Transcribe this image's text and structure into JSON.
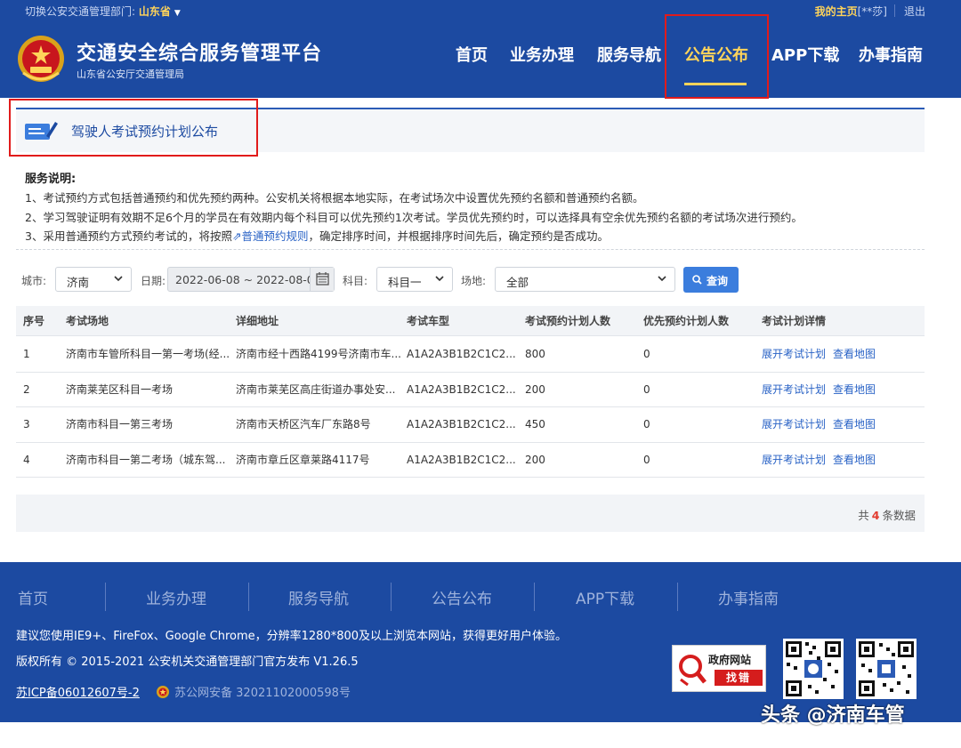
{
  "topbar": {
    "switch_label": "切换公安交通管理部门: ",
    "province": "山东省",
    "my_home": "我的主页",
    "user": "[**莎]",
    "logout": "退出"
  },
  "brand": {
    "title": "交通安全综合服务管理平台",
    "subtitle": "山东省公安厅交通管理局"
  },
  "nav": {
    "items": [
      "首页",
      "业务办理",
      "服务导航",
      "公告公布",
      "APP下载",
      "办事指南"
    ],
    "active": "公告公布"
  },
  "section": {
    "title": "驾驶人考试预约计划公布"
  },
  "service_note": {
    "title": "服务说明:",
    "line1": "1、考试预约方式包括普通预约和优先预约两种。公安机关将根据本地实际，在考试场次中设置优先预约名额和普通预约名额。",
    "line2": "2、学习驾驶证明有效期不足6个月的学员在有效期内每个科目可以优先预约1次考试。学员优先预约时，可以选择具有空余优先预约名额的考试场次进行预约。",
    "line3_a": "3、采用普通预约方式预约考试的，将按照",
    "line3_link": "普通预约规则",
    "line3_b": "，确定排序时间，并根据排序时间先后，确定预约是否成功。"
  },
  "filters": {
    "city_label": "城市:",
    "city_value": "济南",
    "date_label": "日期:",
    "date_value": "2022-06-08 ~ 2022-08-08",
    "subject_label": "科目:",
    "subject_value": "科目一",
    "venue_label": "场地:",
    "venue_value": "全部",
    "query_label": "查询"
  },
  "table": {
    "headers": [
      "序号",
      "考试场地",
      "详细地址",
      "考试车型",
      "考试预约计划人数",
      "优先预约计划人数",
      "考试计划详情"
    ],
    "rows": [
      {
        "no": "1",
        "venue": "济南市车管所科目一第一考场(经...",
        "address": "济南市经十西路4199号济南市车...",
        "vehicle": "A1A2A3B1B2C1C2...",
        "planned": "800",
        "priority": "0",
        "action1": "展开考试计划",
        "action2": "查看地图"
      },
      {
        "no": "2",
        "venue": "济南莱芜区科目一考场",
        "address": "济南市莱芜区高庄街道办事处安...",
        "vehicle": "A1A2A3B1B2C1C2...",
        "planned": "200",
        "priority": "0",
        "action1": "展开考试计划",
        "action2": "查看地图"
      },
      {
        "no": "3",
        "venue": "济南市科目一第三考场",
        "address": "济南市天桥区汽车厂东路8号",
        "vehicle": "A1A2A3B1B2C1C2...",
        "planned": "450",
        "priority": "0",
        "action1": "展开考试计划",
        "action2": "查看地图"
      },
      {
        "no": "4",
        "venue": "济南市科目一第二考场（城东驾...",
        "address": "济南市章丘区章莱路4117号",
        "vehicle": "A1A2A3B1B2C1C2...",
        "planned": "200",
        "priority": "0",
        "action1": "展开考试计划",
        "action2": "查看地图"
      }
    ],
    "total_prefix": "共",
    "total_count": "4",
    "total_suffix": "条数据"
  },
  "footer": {
    "nav": [
      "首页",
      "业务办理",
      "服务导航",
      "公告公布",
      "APP下载",
      "办事指南"
    ],
    "browser_tip": "建议您使用IE9+、FireFox、Google Chrome，分辨率1280*800及以上浏览本网站，获得更好用户体验。",
    "copyright": "版权所有 © 2015-2021 公安机关交通管理部门官方发布 V1.26.5",
    "icp": "苏ICP备06012607号-2",
    "police_record": "苏公网安备 32021102000598号",
    "gov_badge_line1": "政府网站",
    "gov_badge_line2": "找错"
  },
  "watermark": "头条 @济南车管",
  "colors": {
    "header_bg": "#1c4aa1",
    "accent_yellow": "#ffd45a",
    "highlight_red": "#e11b1b",
    "link_blue": "#2a63c6",
    "button_blue": "#3b7ddd"
  }
}
